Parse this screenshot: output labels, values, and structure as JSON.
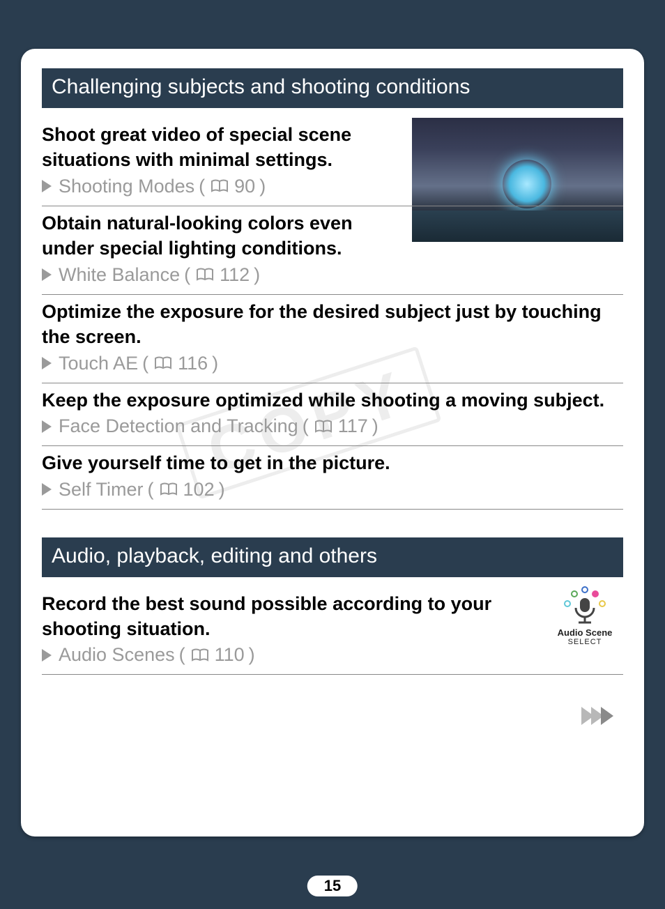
{
  "watermark": "COPY",
  "page_number": "15",
  "sections": [
    {
      "header": "Challenging subjects and shooting conditions",
      "items": [
        {
          "title": "Shoot great video of special scene situations with minimal settings.",
          "link_label": "Shooting Modes",
          "page_ref": "90"
        },
        {
          "title": "Obtain natural-looking colors even under special lighting conditions.",
          "link_label": "White Balance",
          "page_ref": "112"
        },
        {
          "title": "Optimize the exposure for the desired subject just by touching the screen.",
          "link_label": "Touch AE",
          "page_ref": "116"
        },
        {
          "title": "Keep the exposure optimized while shooting a moving subject.",
          "link_label": "Face Detection and Tracking",
          "page_ref": "117"
        },
        {
          "title": "Give yourself time to get in the picture.",
          "link_label": "Self Timer",
          "page_ref": "102"
        }
      ]
    },
    {
      "header": "Audio, playback, editing and others",
      "items": [
        {
          "title": "Record the best sound possible according to your shooting situation.",
          "link_label": "Audio Scenes",
          "page_ref": "110"
        }
      ]
    }
  ],
  "audio_scene_icon": {
    "label": "Audio Scene",
    "sub": "SELECT"
  }
}
